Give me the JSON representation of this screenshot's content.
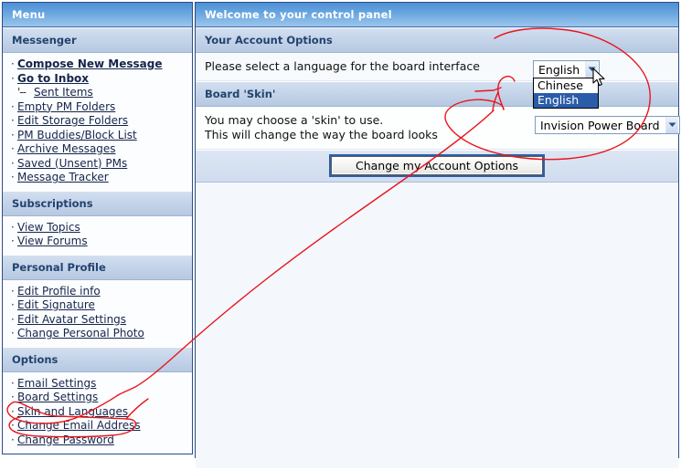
{
  "sidebar": {
    "title": "Menu",
    "sections": [
      {
        "heading": "Messenger",
        "items": [
          {
            "label": "Compose New Message",
            "bullet": "·",
            "bold": true,
            "indent": false
          },
          {
            "label": "Go to Inbox",
            "bullet": "·",
            "bold": true,
            "indent": false
          },
          {
            "label": "Sent Items",
            "bullet": "'--",
            "bold": false,
            "indent": true
          },
          {
            "label": "Empty PM Folders",
            "bullet": "·",
            "bold": false,
            "indent": false
          },
          {
            "label": "Edit Storage Folders",
            "bullet": "·",
            "bold": false,
            "indent": false
          },
          {
            "label": "PM Buddies/Block List",
            "bullet": "·",
            "bold": false,
            "indent": false
          },
          {
            "label": "Archive Messages",
            "bullet": "·",
            "bold": false,
            "indent": false
          },
          {
            "label": "Saved (Unsent) PMs",
            "bullet": "·",
            "bold": false,
            "indent": false
          },
          {
            "label": "Message Tracker",
            "bullet": "·",
            "bold": false,
            "indent": false
          }
        ]
      },
      {
        "heading": "Subscriptions",
        "items": [
          {
            "label": "View Topics",
            "bullet": "·",
            "bold": false,
            "indent": false
          },
          {
            "label": "View Forums",
            "bullet": "·",
            "bold": false,
            "indent": false
          }
        ]
      },
      {
        "heading": "Personal Profile",
        "items": [
          {
            "label": "Edit Profile info",
            "bullet": "·",
            "bold": false,
            "indent": false
          },
          {
            "label": "Edit Signature",
            "bullet": "·",
            "bold": false,
            "indent": false
          },
          {
            "label": "Edit Avatar Settings",
            "bullet": "·",
            "bold": false,
            "indent": false
          },
          {
            "label": "Change Personal Photo",
            "bullet": "·",
            "bold": false,
            "indent": false
          }
        ]
      },
      {
        "heading": "Options",
        "items": [
          {
            "label": "Email Settings",
            "bullet": "·",
            "bold": false,
            "indent": false
          },
          {
            "label": "Board Settings",
            "bullet": "·",
            "bold": false,
            "indent": false
          },
          {
            "label": "Skin and Languages",
            "bullet": "·",
            "bold": false,
            "indent": false
          },
          {
            "label": "Change Email Address",
            "bullet": "·",
            "bold": false,
            "indent": false
          },
          {
            "label": "Change Password",
            "bullet": "·",
            "bold": false,
            "indent": false
          }
        ]
      }
    ]
  },
  "main": {
    "title": "Welcome to your control panel",
    "account_options": {
      "heading": "Your Account Options",
      "language_prompt": "Please select a language for the board interface",
      "language_selected": "English",
      "language_options": [
        "Chinese",
        "English"
      ],
      "language_highlighted": "English"
    },
    "board_skin": {
      "heading": "Board 'Skin'",
      "line1": "You may choose a 'skin' to use.",
      "line2": "This will change the way the board looks",
      "skin_selected": "Invision Power Board"
    },
    "submit_label": "Change my Account Options"
  },
  "annotation": {
    "color": "#e8151b",
    "shapes": [
      "circle-around-language-and-skin-selectors",
      "ellipse-around-skin-and-languages-link",
      "connector-line"
    ]
  },
  "cursor": {
    "type": "arrow-pointer"
  }
}
